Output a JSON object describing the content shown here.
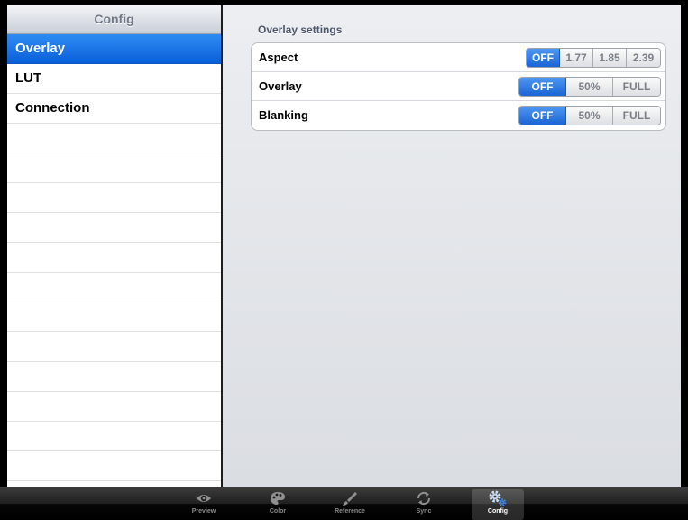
{
  "master": {
    "title": "Config",
    "items": [
      {
        "label": "Overlay",
        "selected": true
      },
      {
        "label": "LUT",
        "selected": false
      },
      {
        "label": "Connection",
        "selected": false
      }
    ]
  },
  "detail": {
    "section_header": "Overlay settings",
    "rows": [
      {
        "label": "Aspect",
        "options": [
          "OFF",
          "1.77",
          "1.85",
          "2.39"
        ],
        "selected": "OFF"
      },
      {
        "label": "Overlay",
        "options": [
          "OFF",
          "50%",
          "FULL"
        ],
        "selected": "OFF"
      },
      {
        "label": "Blanking",
        "options": [
          "OFF",
          "50%",
          "FULL"
        ],
        "selected": "OFF"
      }
    ]
  },
  "tabbar": {
    "tabs": [
      {
        "label": "Preview",
        "icon": "eye-icon",
        "active": false
      },
      {
        "label": "Color",
        "icon": "palette-icon",
        "active": false
      },
      {
        "label": "Reference",
        "icon": "brush-icon",
        "active": false
      },
      {
        "label": "Sync",
        "icon": "sync-icon",
        "active": false
      },
      {
        "label": "Config",
        "icon": "gears-icon",
        "active": true
      }
    ]
  },
  "colors": {
    "selection_blue": "#0a5fd8",
    "segment_on": "#1a64d5",
    "tabbar": "#000000"
  }
}
